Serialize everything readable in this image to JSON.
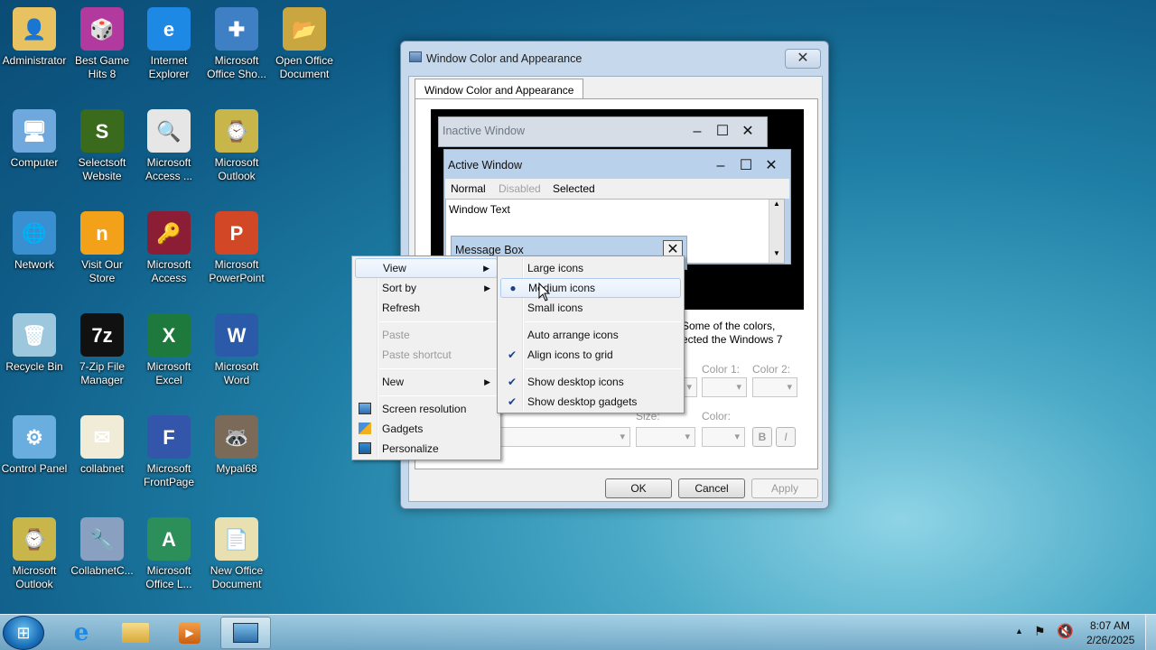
{
  "desktop_icons": [
    {
      "label": "Administrator",
      "icon": "user-folder-icon",
      "color": "#e8c260",
      "glyph": "👤"
    },
    {
      "label": "Best Game Hits 8",
      "icon": "game-dice-icon",
      "color": "#b23a9e",
      "glyph": "🎲"
    },
    {
      "label": "Internet Explorer",
      "icon": "internet-explorer-icon",
      "color": "#1e88e5",
      "glyph": "e"
    },
    {
      "label": "Microsoft Office Sho...",
      "icon": "office-shortcut-icon",
      "color": "#3f7fc4",
      "glyph": "✚"
    },
    {
      "label": "Open Office Document",
      "icon": "open-office-document-icon",
      "color": "#c9a640",
      "glyph": "📂"
    },
    {
      "label": "Computer",
      "icon": "computer-icon",
      "color": "#6fa8dc",
      "glyph": "🖥"
    },
    {
      "label": "Selectsoft Website",
      "icon": "selectsoft-icon",
      "color": "#3a6b1c",
      "glyph": "S"
    },
    {
      "label": "Microsoft Access ...",
      "icon": "access-document-icon",
      "color": "#e6e6e6",
      "glyph": "🔍"
    },
    {
      "label": "Microsoft Outlook",
      "icon": "outlook-icon",
      "color": "#c8b64a",
      "glyph": "⌚"
    },
    {
      "label": "Network",
      "icon": "network-icon",
      "color": "#3a8fd0",
      "glyph": "🌐"
    },
    {
      "label": "Visit Our Store",
      "icon": "store-icon",
      "color": "#f4a11a",
      "glyph": "n"
    },
    {
      "label": "Microsoft Access",
      "icon": "access-icon",
      "color": "#8b1d35",
      "glyph": "🔑"
    },
    {
      "label": "Microsoft PowerPoint",
      "icon": "powerpoint-icon",
      "color": "#d24726",
      "glyph": "P"
    },
    {
      "label": "Recycle Bin",
      "icon": "recycle-bin-icon",
      "color": "#9cc7dd",
      "glyph": "🗑"
    },
    {
      "label": "7-Zip File Manager",
      "icon": "7zip-icon",
      "color": "#111111",
      "glyph": "7z"
    },
    {
      "label": "Microsoft Excel",
      "icon": "excel-icon",
      "color": "#1d7a3c",
      "glyph": "X"
    },
    {
      "label": "Microsoft Word",
      "icon": "word-icon",
      "color": "#2b5aa8",
      "glyph": "W"
    },
    {
      "label": "Control Panel",
      "icon": "control-panel-icon",
      "color": "#6aaee0",
      "glyph": "⚙"
    },
    {
      "label": "collabnet",
      "icon": "certificate-icon",
      "color": "#f0ecd8",
      "glyph": "✉"
    },
    {
      "label": "Microsoft FrontPage",
      "icon": "frontpage-icon",
      "color": "#3355aa",
      "glyph": "F"
    },
    {
      "label": "Mypal68",
      "icon": "raccoon-icon",
      "color": "#7b6a58",
      "glyph": "🦝"
    },
    {
      "label": "Microsoft Outlook",
      "icon": "outlook-icon",
      "color": "#c8b64a",
      "glyph": "⌚"
    },
    {
      "label": "CollabnetC...",
      "icon": "collabnet-client-icon",
      "color": "#8aa0c0",
      "glyph": "🔧"
    },
    {
      "label": "Microsoft Office L...",
      "icon": "office-language-icon",
      "color": "#2c8f5a",
      "glyph": "A"
    },
    {
      "label": "New Office Document",
      "icon": "new-office-document-icon",
      "color": "#e8e0b0",
      "glyph": "📄"
    }
  ],
  "window": {
    "title": "Window Color and Appearance",
    "tab": "Window Color and Appearance",
    "preview": {
      "inactive_title": "Inactive Window",
      "active_title": "Active Window",
      "menu_normal": "Normal",
      "menu_disabled": "Disabled",
      "menu_selected": "Selected",
      "window_text": "Window Text",
      "message_box_title": "Message Box"
    },
    "description_line1": "Some of the colors,",
    "description_line2": "ected the Windows 7",
    "color1_label": "Color 1:",
    "color2_label": "Color 2:",
    "size_label": "Size:",
    "color_label": "Color:",
    "bold_label": "B",
    "italic_label": "I",
    "ok_label": "OK",
    "cancel_label": "Cancel",
    "apply_label": "Apply"
  },
  "context_menu": {
    "view": "View",
    "sort_by": "Sort by",
    "refresh": "Refresh",
    "paste": "Paste",
    "paste_shortcut": "Paste shortcut",
    "new": "New",
    "screen_resolution": "Screen resolution",
    "gadgets": "Gadgets",
    "personalize": "Personalize"
  },
  "view_submenu": {
    "large_icons": "Large icons",
    "medium_icons": "Medium icons",
    "small_icons": "Small icons",
    "auto_arrange": "Auto arrange icons",
    "align_to_grid": "Align icons to grid",
    "show_desktop_icons": "Show desktop icons",
    "show_desktop_gadgets": "Show desktop gadgets",
    "selected": "Medium icons",
    "checked": [
      "Align icons to grid",
      "Show desktop icons",
      "Show desktop gadgets"
    ]
  },
  "taskbar": {
    "time": "8:07 AM",
    "date": "2/26/2025"
  }
}
